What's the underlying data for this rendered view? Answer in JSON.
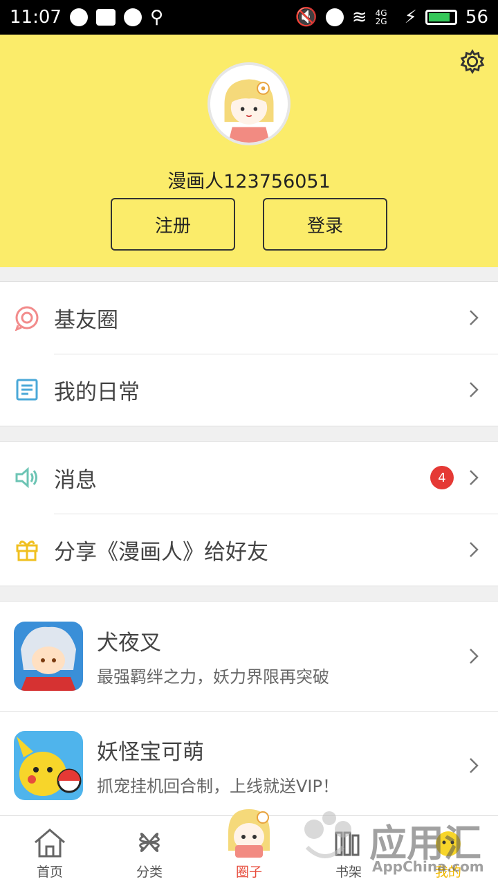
{
  "status_bar": {
    "time": "11:07",
    "signal": "4G 2G",
    "battery": "56"
  },
  "profile": {
    "username": "漫画人123756051",
    "register_label": "注册",
    "login_label": "登录"
  },
  "menu1": [
    {
      "label": "基友圈",
      "icon": "chat-circle-icon"
    },
    {
      "label": "我的日常",
      "icon": "note-icon"
    }
  ],
  "menu2": [
    {
      "label": "消息",
      "icon": "speaker-icon",
      "badge": "4"
    },
    {
      "label": "分享《漫画人》给好友",
      "icon": "gift-icon"
    }
  ],
  "apps": [
    {
      "title": "犬夜叉",
      "desc": "最强羁绊之力，妖力界限再突破"
    },
    {
      "title": "妖怪宝可萌",
      "desc": "抓宠挂机回合制，上线就送VIP！"
    }
  ],
  "tabs": [
    {
      "label": "首页"
    },
    {
      "label": "分类"
    },
    {
      "label": "圈子"
    },
    {
      "label": "书架"
    },
    {
      "label": "我的"
    }
  ],
  "watermark": {
    "brand": "应用汇",
    "site": "AppChina.com"
  },
  "colors": {
    "header": "#fbec6a",
    "badge": "#e53935",
    "active_tab": "#f0b800"
  }
}
